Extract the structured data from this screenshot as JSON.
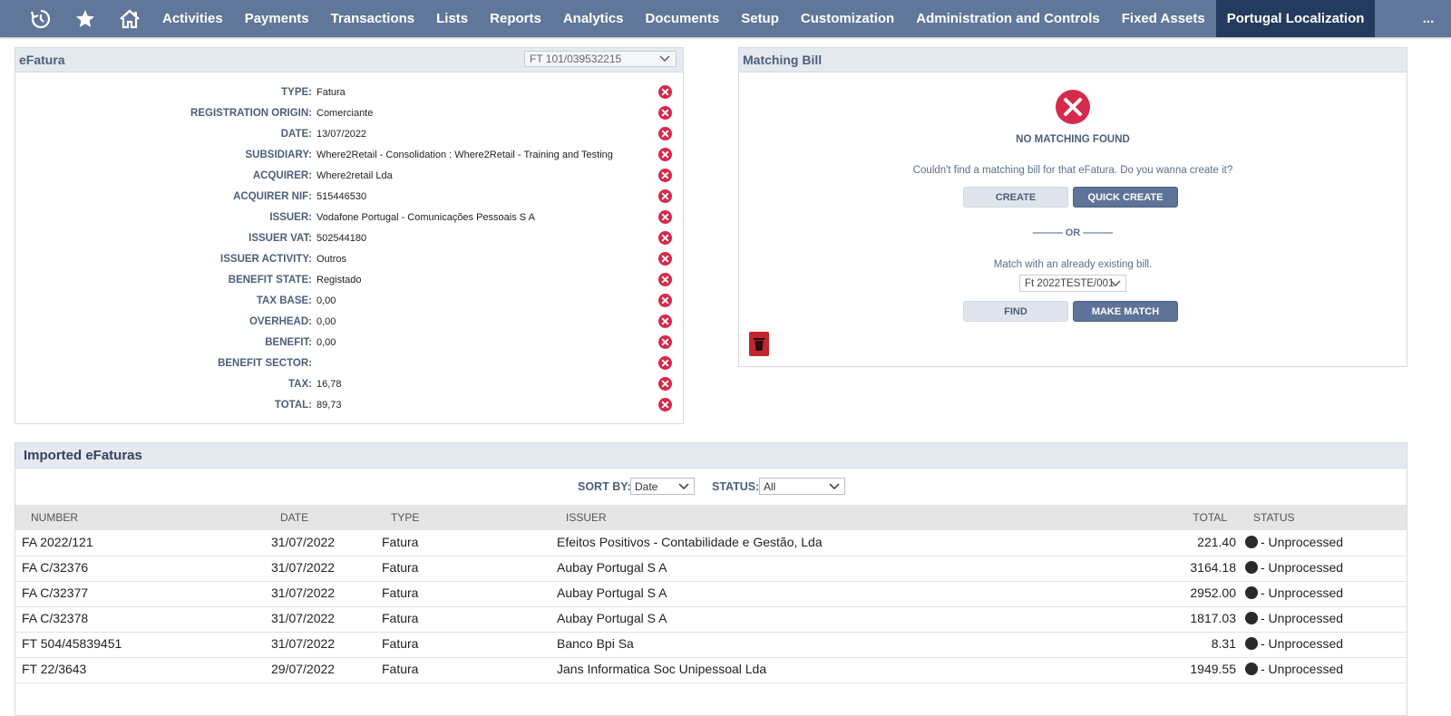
{
  "nav": {
    "icons": [
      "recent-icon",
      "star-icon",
      "home-icon"
    ],
    "items": [
      "Activities",
      "Payments",
      "Transactions",
      "Lists",
      "Reports",
      "Analytics",
      "Documents",
      "Setup",
      "Customization",
      "Administration and Controls",
      "Fixed Assets",
      "Portugal Localization"
    ],
    "active": "Portugal Localization",
    "more": "..."
  },
  "efatura": {
    "title": "eFatura",
    "document_select": "FT 101/039532215",
    "fields": [
      {
        "label": "TYPE:",
        "value": "Fatura"
      },
      {
        "label": "REGISTRATION ORIGIN:",
        "value": "Comerciante"
      },
      {
        "label": "DATE:",
        "value": "13/07/2022"
      },
      {
        "label": "SUBSIDIARY:",
        "value": "Where2Retail - Consolidation : Where2Retail - Training and Testing"
      },
      {
        "label": "ACQUIRER:",
        "value": "Where2retail Lda"
      },
      {
        "label": "ACQUIRER NIF:",
        "value": "515446530"
      },
      {
        "label": "ISSUER:",
        "value": "Vodafone Portugal - Comunicações Pessoais S A"
      },
      {
        "label": "ISSUER VAT:",
        "value": "502544180"
      },
      {
        "label": "ISSUER ACTIVITY:",
        "value": "Outros"
      },
      {
        "label": "BENEFIT STATE:",
        "value": "Registado"
      },
      {
        "label": "TAX BASE:",
        "value": "0,00"
      },
      {
        "label": "OVERHEAD:",
        "value": "0,00"
      },
      {
        "label": "BENEFIT:",
        "value": "0,00"
      },
      {
        "label": "BENEFIT SECTOR:",
        "value": ""
      },
      {
        "label": "TAX:",
        "value": "16,78"
      },
      {
        "label": "TOTAL:",
        "value": "89,73"
      }
    ]
  },
  "matching": {
    "title": "Matching Bill",
    "no_match": "NO MATCHING FOUND",
    "message": "Couldn't find a matching bill for that eFatura. Do you wanna create it?",
    "create_label": "CREATE",
    "quick_create_label": "QUICK CREATE",
    "or_text": "——— OR ———",
    "match_with": "Match with an already existing bill.",
    "bill_select": "Ft 2022TESTE/001",
    "find_label": "FIND",
    "make_match_label": "MAKE MATCH"
  },
  "imported": {
    "title": "Imported eFaturas",
    "sort_by_label": "SORT BY:",
    "sort_by_value": "Date",
    "status_label": "STATUS:",
    "status_value": "All",
    "columns": [
      "NUMBER",
      "DATE",
      "TYPE",
      "ISSUER",
      "TOTAL",
      "STATUS"
    ],
    "rows": [
      {
        "number": "FA 2022/121",
        "date": "31/07/2022",
        "type": "Fatura",
        "issuer": "Efeitos Positivos - Contabilidade e Gestão, Lda",
        "total": "221.40",
        "status": "- Unprocessed"
      },
      {
        "number": "FA C/32376",
        "date": "31/07/2022",
        "type": "Fatura",
        "issuer": "Aubay Portugal S A",
        "total": "3164.18",
        "status": "- Unprocessed"
      },
      {
        "number": "FA C/32377",
        "date": "31/07/2022",
        "type": "Fatura",
        "issuer": "Aubay Portugal S A",
        "total": "2952.00",
        "status": "- Unprocessed"
      },
      {
        "number": "FA C/32378",
        "date": "31/07/2022",
        "type": "Fatura",
        "issuer": "Aubay Portugal S A",
        "total": "1817.03",
        "status": "- Unprocessed"
      },
      {
        "number": "FT 504/45839451",
        "date": "31/07/2022",
        "type": "Fatura",
        "issuer": "Banco Bpi Sa",
        "total": "8.31",
        "status": "- Unprocessed"
      },
      {
        "number": "FT 22/3643",
        "date": "29/07/2022",
        "type": "Fatura",
        "issuer": "Jans Informatica Soc Unipessoal Lda",
        "total": "1949.55",
        "status": "- Unprocessed"
      }
    ]
  },
  "colors": {
    "nav_bg": "#607799",
    "nav_active": "#243a5e",
    "error_red": "#d6294b",
    "label_blue": "#4d5f79"
  }
}
